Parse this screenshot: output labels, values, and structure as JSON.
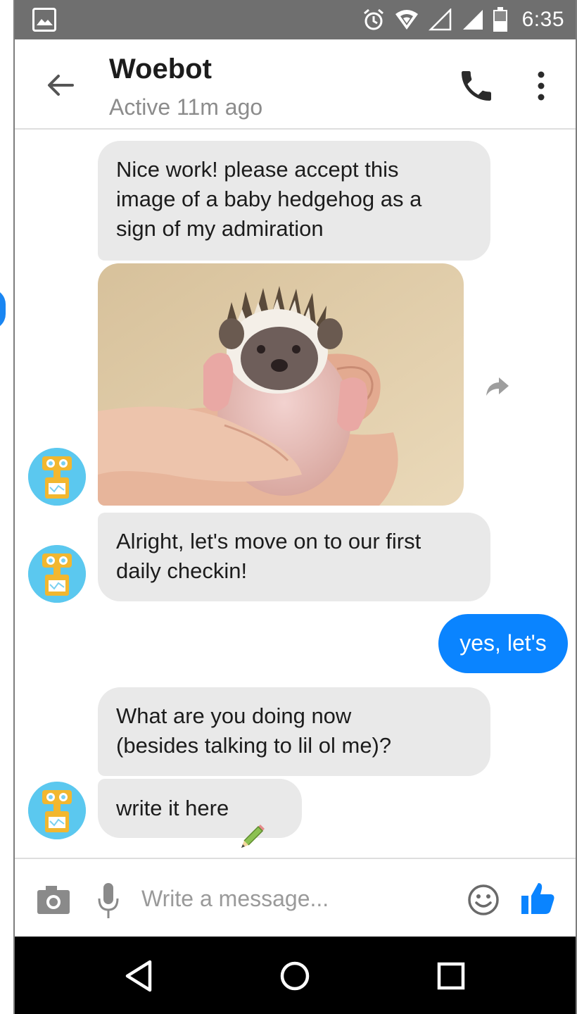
{
  "status_bar": {
    "time": "6:35",
    "icons": [
      "gallery-icon",
      "alarm-icon",
      "wifi-icon",
      "signal-icon",
      "signal-icon",
      "battery-icon"
    ]
  },
  "header": {
    "contact_name": "Woebot",
    "contact_status": "Active 11m ago",
    "icons": [
      "back-arrow-icon",
      "phone-icon",
      "more-vert-icon"
    ]
  },
  "messages": [
    {
      "sender": "bot",
      "text": "Nice work! please accept this\nimage of a baby hedgehog as a\nsign of my admiration"
    },
    {
      "sender": "bot",
      "type": "image",
      "subject": "baby-hedgehog",
      "icon": "share-icon"
    },
    {
      "sender": "bot",
      "text": "Alright, let's move on to our first\ndaily checkin!"
    },
    {
      "sender": "user",
      "text": "yes, let's"
    },
    {
      "sender": "bot",
      "text": "What are you doing now\n(besides talking to lil ol me)?"
    },
    {
      "sender": "bot",
      "type": "quick-reply",
      "text": "write it here",
      "icon": "pencil-icon"
    }
  ],
  "composer": {
    "placeholder": "Write a message...",
    "icons": [
      "camera-icon",
      "mic-icon",
      "emoji-icon",
      "thumbs-up-icon"
    ]
  },
  "nav_bar": {
    "icons": [
      "nav-back-icon",
      "nav-home-icon",
      "nav-recents-icon"
    ]
  },
  "colors": {
    "accent": "#0a84ff",
    "bot_bubble": "#e9e9e9",
    "status_bar": "#6f6f6f",
    "avatar_bg": "#5bc8ef",
    "robot_head": "#f2b72f"
  }
}
